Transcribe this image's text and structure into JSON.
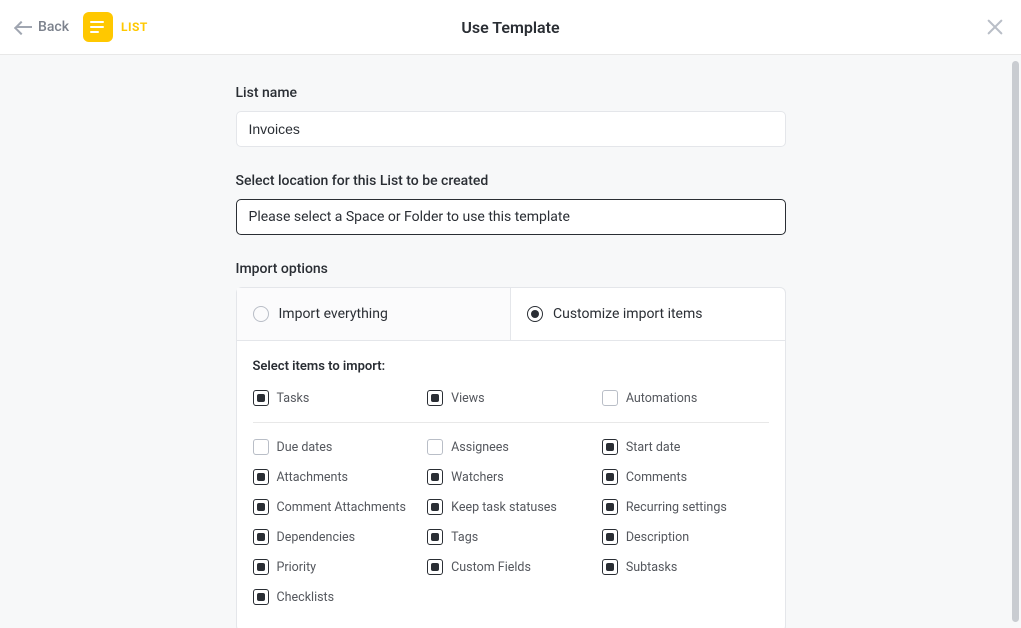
{
  "header": {
    "back_label": "Back",
    "type_label": "LIST",
    "title": "Use Template"
  },
  "list_name": {
    "label": "List name",
    "value": "Invoices"
  },
  "location": {
    "label": "Select location for this List to be created",
    "placeholder": "Please select a Space or Folder to use this template"
  },
  "import": {
    "label": "Import options",
    "radios": {
      "everything": "Import everything",
      "customize": "Customize import items",
      "selected": "customize"
    },
    "items_title": "Select items to import:",
    "top_items": [
      {
        "label": "Tasks",
        "checked": true
      },
      {
        "label": "Views",
        "checked": true
      },
      {
        "label": "Automations",
        "checked": false
      }
    ],
    "items": [
      {
        "label": "Due dates",
        "checked": false
      },
      {
        "label": "Assignees",
        "checked": false
      },
      {
        "label": "Start date",
        "checked": true
      },
      {
        "label": "Attachments",
        "checked": true
      },
      {
        "label": "Watchers",
        "checked": true
      },
      {
        "label": "Comments",
        "checked": true
      },
      {
        "label": "Comment Attachments",
        "checked": true
      },
      {
        "label": "Keep task statuses",
        "checked": true
      },
      {
        "label": "Recurring settings",
        "checked": true
      },
      {
        "label": "Dependencies",
        "checked": true
      },
      {
        "label": "Tags",
        "checked": true
      },
      {
        "label": "Description",
        "checked": true
      },
      {
        "label": "Priority",
        "checked": true
      },
      {
        "label": "Custom Fields",
        "checked": true
      },
      {
        "label": "Subtasks",
        "checked": true
      },
      {
        "label": "Checklists",
        "checked": true
      }
    ]
  }
}
